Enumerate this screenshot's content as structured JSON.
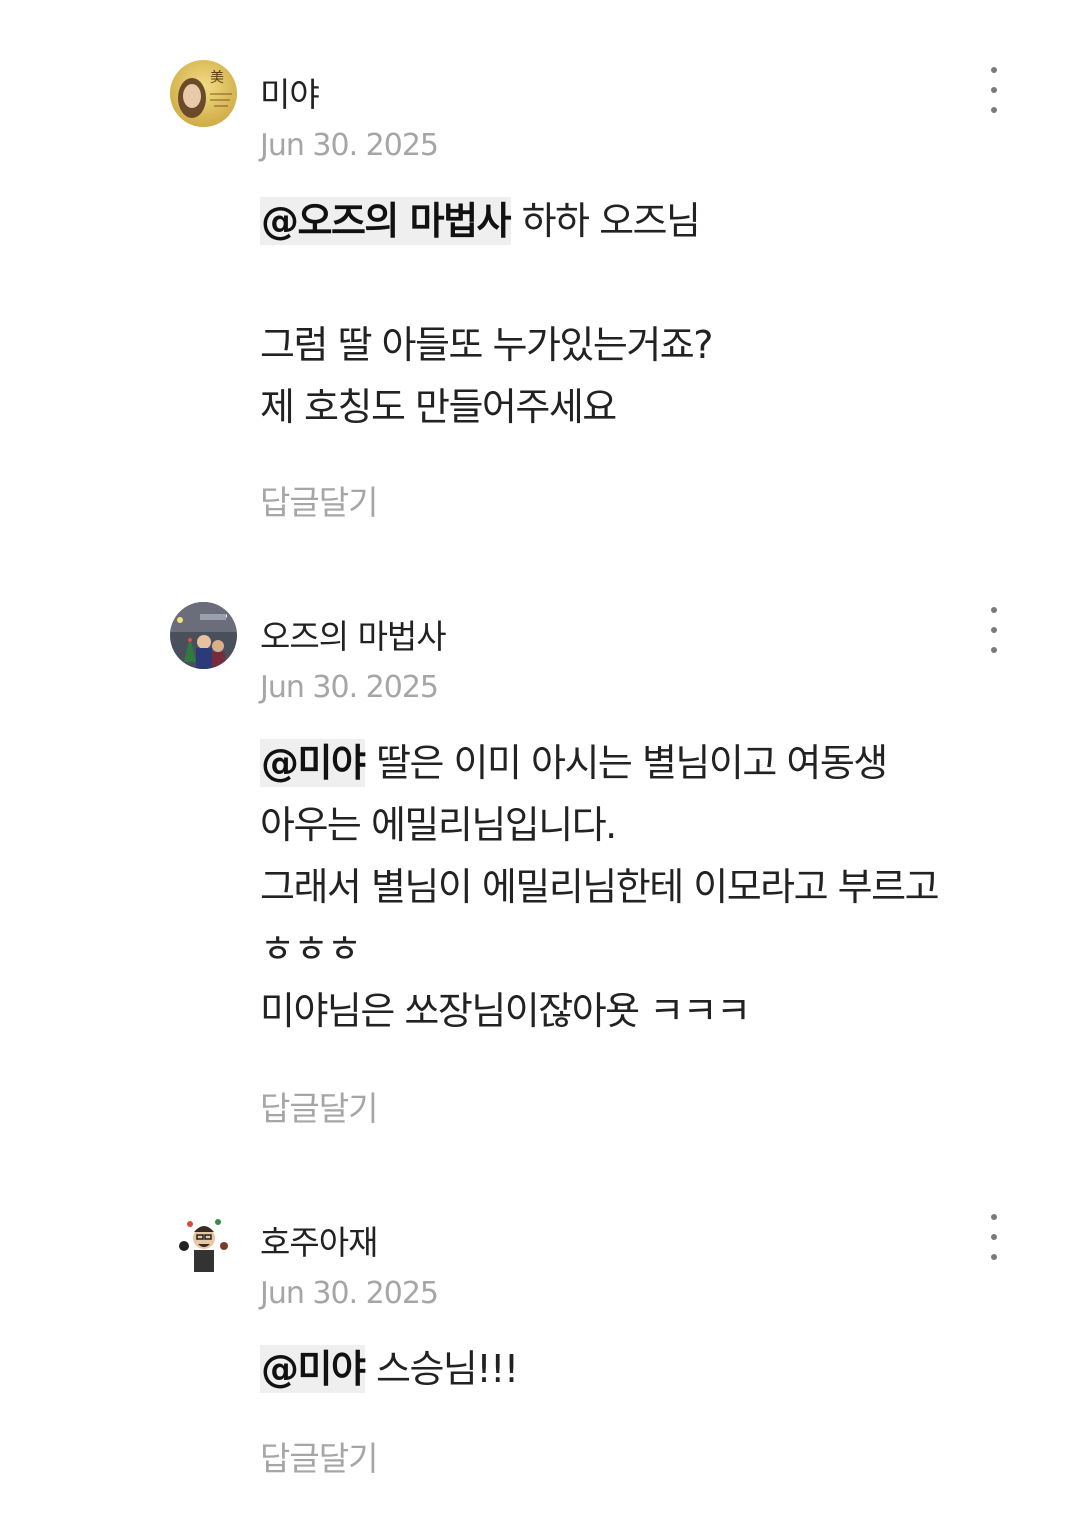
{
  "comments": [
    {
      "author": "미야",
      "date": "Jun 30. 2025",
      "mention": "@오즈의 마법사",
      "lines": [
        " 하하 오즈님",
        "",
        "그럼 딸 아들또 누가있는거죠?",
        "제 호칭도 만들어주세요"
      ],
      "reply_label": "답글달기",
      "avatar_text": "美"
    },
    {
      "author": "오즈의 마법사",
      "date": "Jun 30. 2025",
      "mention": "@미야",
      "lines": [
        " 딸은 이미 아시는 별님이고 여동생",
        "아우는 에밀리님입니다.",
        "그래서 별님이 에밀리님한테 이모라고 부르고",
        "ㅎㅎㅎ",
        "미야님은 쏘장님이잖아욧 ㅋㅋㅋ"
      ],
      "reply_label": "답글달기"
    },
    {
      "author": "호주아재",
      "date": "Jun 30. 2025",
      "mention": "@미야",
      "lines": [
        " 스승님!!!"
      ],
      "reply_label": "답글달기"
    }
  ],
  "icons": {
    "more": "more-vertical-icon",
    "avatar": "user-avatar"
  },
  "colors": {
    "text": "#222222",
    "muted": "#a6a6a6",
    "mention_bg": "#efefef"
  }
}
